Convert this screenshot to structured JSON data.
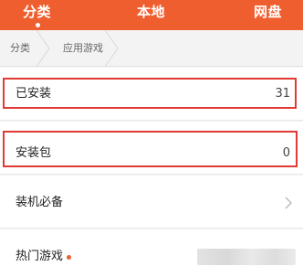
{
  "tabs": [
    {
      "label": "分类",
      "active": true
    },
    {
      "label": "本地",
      "active": false
    },
    {
      "label": "网盘",
      "active": false
    }
  ],
  "breadcrumb": [
    "分类",
    "应用游戏"
  ],
  "rows": [
    {
      "label": "已安装",
      "value": "31",
      "highlighted": true
    },
    {
      "label": "安装包",
      "value": "0",
      "highlighted": true
    },
    {
      "label": "装机必备",
      "chevron": true
    },
    {
      "label": "热门游戏",
      "badge": true
    }
  ],
  "colors": {
    "header": "#ef5e2e",
    "highlight_border": "#e03a33",
    "badge_dot": "#e8602c"
  }
}
